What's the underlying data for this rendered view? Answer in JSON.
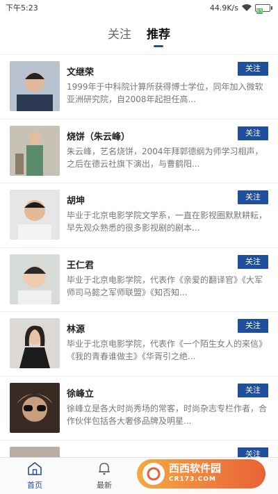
{
  "status_bar": {
    "time": "下午5:23",
    "network_speed": "44.9K/s",
    "battery": "65"
  },
  "top_tabs": [
    {
      "label": "关注",
      "active": false
    },
    {
      "label": "推荐",
      "active": true
    }
  ],
  "follow_label": "关注",
  "people": [
    {
      "name": "文继荣",
      "desc": "1999年于中科院计算所获得博士学位，同年加入微软亚洲研究院，自2008年起担任高..."
    },
    {
      "name": "烧饼（朱云峰）",
      "desc": "朱云峰，艺名烧饼，2004年拜郭德纲为师学习相声，之后在德云社旗下演出，与曹鹤阳..."
    },
    {
      "name": "胡坤",
      "desc": "毕业于北京电影学院文学系，一直在影视圈默默耕耘，早先观众熟悉的很多影视剧的剧本..."
    },
    {
      "name": "王仁君",
      "desc": "毕业于北京电影学院，代表作《亲爱的翻译官》《大军师司马懿之军师联盟》《知否知..."
    },
    {
      "name": "林源",
      "desc": "毕业于北京电影学院，代表作《一个陌生女人的来信》《我的青春谁做主》《华胥引之绝..."
    },
    {
      "name": "徐峰立",
      "desc": "徐峰立是各大时尚秀场的常客，时尚杂志专栏作者，合作伙伴包括各大奢侈品牌及明星..."
    },
    {
      "name": "",
      "desc": ""
    }
  ],
  "bottom_nav": [
    {
      "label": "首页",
      "icon": "home-icon",
      "active": true
    },
    {
      "label": "最新",
      "icon": "bell-icon",
      "active": false
    }
  ],
  "watermark": {
    "main": "西西软件园",
    "sub": "CR173.COM"
  },
  "colors": {
    "accent": "#1f4f9c"
  }
}
